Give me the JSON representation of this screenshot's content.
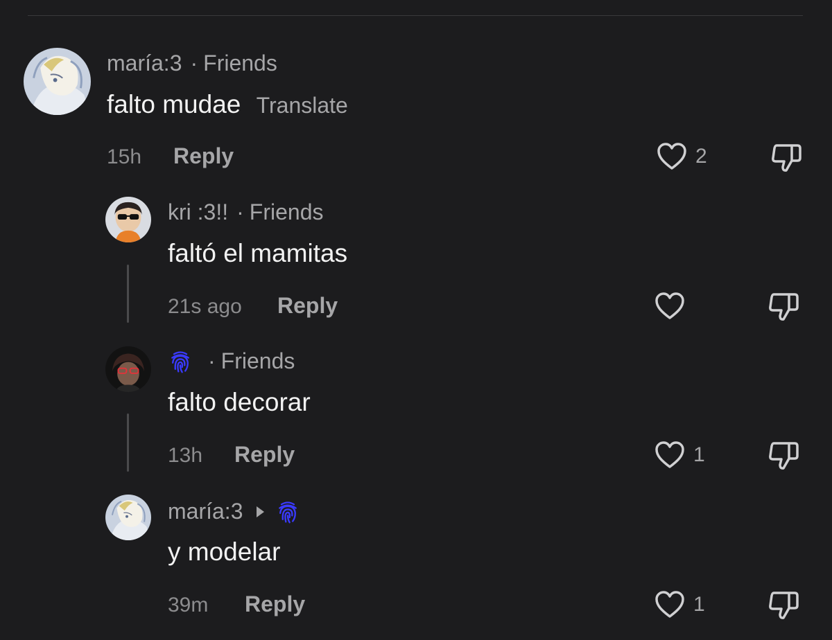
{
  "comments": [
    {
      "author": "maría:3",
      "separator": "·",
      "relation": "Friends",
      "text": "falto mudae",
      "translate_label": "Translate",
      "time": "15h",
      "reply_label": "Reply",
      "likes": "2"
    },
    {
      "author": "kri :3!!",
      "separator": "·",
      "relation": "Friends",
      "text": "faltó el mamitas",
      "time": "21s ago",
      "reply_label": "Reply",
      "likes": ""
    },
    {
      "author_icon": "fingerprint-emoji",
      "separator": "·",
      "relation": "Friends",
      "text": "falto decorar",
      "time": "13h",
      "reply_label": "Reply",
      "likes": "1"
    },
    {
      "author": "maría:3",
      "reply_to_icon": "fingerprint-emoji",
      "text": "y modelar",
      "time": "39m",
      "reply_label": "Reply",
      "likes": "1"
    }
  ],
  "icons": {
    "like": "heart-outline-icon",
    "dislike": "thumbs-down-outline-icon",
    "reply_arrow": "caret-right-icon"
  },
  "colors": {
    "background": "#1c1c1e",
    "primary_text": "#f2f2f2",
    "secondary_text": "#a6a6a8",
    "fingerprint": "#3a3aff"
  }
}
